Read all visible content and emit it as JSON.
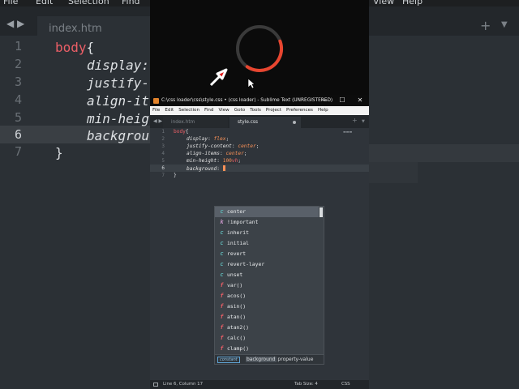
{
  "background_editor": {
    "menu": [
      "File",
      "Edit",
      "Selection",
      "Find",
      "View",
      "Help"
    ],
    "tab_label": "index.htm",
    "line_numbers": [
      "1",
      "2",
      "3",
      "4",
      "5",
      "6",
      "7"
    ],
    "lines": {
      "l1_selector": "body",
      "l1_brace": "{",
      "l2": "display:",
      "l3": "justify-",
      "l4": "align-it",
      "l5": "min-heig",
      "l6": "backgrou",
      "l7_brace": "}"
    }
  },
  "window": {
    "title": "C:\\css loader\\css\\style.css • (css loader) - Sublime Text (UNREGISTERED)",
    "controls": [
      "—",
      "☐",
      "✕"
    ],
    "menu": [
      "File",
      "Edit",
      "Selection",
      "Find",
      "View",
      "Goto",
      "Tools",
      "Project",
      "Preferences",
      "Help"
    ],
    "tabs": [
      {
        "label": "index.htm",
        "active": false
      },
      {
        "label": "style.css",
        "active": true,
        "modified": true
      }
    ]
  },
  "editor": {
    "line_numbers": [
      "1",
      "2",
      "3",
      "4",
      "5",
      "6",
      "7"
    ],
    "current_line": "6",
    "code": {
      "l1_selector": "body",
      "l1_brace": "{",
      "l2_prop": "display",
      "l2_val": "flex",
      "l3_prop": "justify-content",
      "l3_val": "center",
      "l4_prop": "align-items",
      "l4_val": "center",
      "l5_prop": "min-height",
      "l5_num": "100",
      "l5_unit": "vh",
      "l6_prop": "background",
      "l7_brace": "}"
    }
  },
  "autocomplete": {
    "items": [
      {
        "kind": "c",
        "label": "center",
        "selected": true
      },
      {
        "kind": "k",
        "label": "!important"
      },
      {
        "kind": "c",
        "label": "inherit"
      },
      {
        "kind": "c",
        "label": "initial"
      },
      {
        "kind": "c",
        "label": "revert"
      },
      {
        "kind": "c",
        "label": "revert-layer"
      },
      {
        "kind": "c",
        "label": "unset"
      },
      {
        "kind": "f",
        "label": "var()"
      },
      {
        "kind": "f",
        "label": "acos()"
      },
      {
        "kind": "f",
        "label": "asin()"
      },
      {
        "kind": "f",
        "label": "atan()"
      },
      {
        "kind": "f",
        "label": "atan2()"
      },
      {
        "kind": "f",
        "label": "calc()"
      },
      {
        "kind": "f",
        "label": "clamp()"
      }
    ],
    "footer_kind": "constant",
    "footer_highlight": "background",
    "footer_rest": "property-value"
  },
  "statusbar": {
    "position": "Line 6, Column 17",
    "tab_size": "Tab Size: 4",
    "syntax": "CSS"
  },
  "colors": {
    "loader_track": "#3a3a3a",
    "loader_accent": "#e8452f",
    "arrow": "#e21b1b"
  },
  "loader": {
    "progress": 0.4
  }
}
